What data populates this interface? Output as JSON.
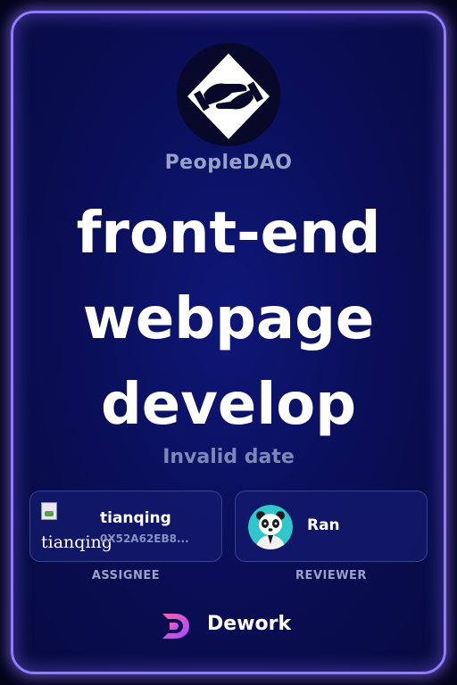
{
  "org": {
    "name": "PeopleDAO",
    "logo_icon": "handshake-icon"
  },
  "task": {
    "title_lines": [
      "front-end",
      "webpage",
      "develop"
    ],
    "date": "Invalid date"
  },
  "assignee": {
    "name": "tianqing",
    "address": "0X52A62EB8...",
    "avatar_alt": "tianqing",
    "role_label": "ASSIGNEE"
  },
  "reviewer": {
    "name": "Ran",
    "avatar_icon": "panda-avatar",
    "role_label": "REVIEWER"
  },
  "brand": {
    "name": "Dework",
    "logo_icon": "dework-logo-icon"
  },
  "colors": {
    "accent": "#8f7bff",
    "card_bg": "#0a0f5a",
    "text_muted": "#9aa1c9"
  }
}
